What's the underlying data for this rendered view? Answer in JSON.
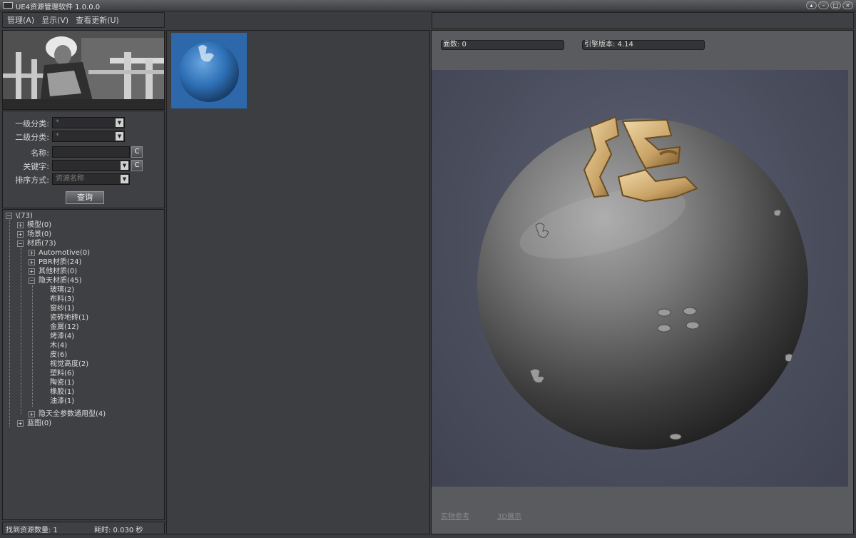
{
  "window": {
    "title": "UE4资源管理软件 1.0.0.0",
    "controls": [
      "restore",
      "minimize",
      "maximize",
      "close"
    ]
  },
  "menu": {
    "items": [
      "管理(A)",
      "显示(V)",
      "查看更新(U)"
    ]
  },
  "filters": {
    "category1_label": "一级分类:",
    "category1_value": "*",
    "category2_label": "二级分类:",
    "category2_value": "*",
    "name_label": "名称:",
    "name_value": "",
    "keyword_label": "关键字:",
    "keyword_value": "",
    "sort_label": "排序方式:",
    "sort_value": "资源名称",
    "clear_label": "C",
    "query_label": "查询"
  },
  "tree": {
    "root": "\\(73)",
    "nodes": {
      "models": "模型(0)",
      "scenes": "场景(0)",
      "materials": "材质(73)",
      "automotive": "Automotive(0)",
      "pbr": "PBR材质(24)",
      "other": "其他材质(0)",
      "yintian": "隐天材质(45)",
      "glass": "玻璃(2)",
      "fabric": "布料(3)",
      "curtain": "窗纱(1)",
      "tile": "瓷砖地砖(1)",
      "metal": "金属(12)",
      "paint_baked": "烤漆(4)",
      "wood": "木(4)",
      "leather": "皮(6)",
      "parallax": "视觉高度(2)",
      "plastic": "塑料(6)",
      "ceramic": "陶瓷(1)",
      "rubber": "橡胶(1)",
      "oil_paint": "油漆(1)",
      "yintian_params": "隐天全参数通用型(4)",
      "blueprint": "蓝图(0)"
    }
  },
  "status": {
    "found": "找到资源数量: 1",
    "elapsed": "耗时: 0.030 秒"
  },
  "info": {
    "faces": "面数: 0",
    "engine": "引擎版本: 4.14"
  },
  "links": {
    "instance": "实物参考",
    "view3d": "3D展示"
  },
  "colors": {
    "tile_bg": "#2c68aa",
    "panel_bg": "#3f4043",
    "viewport_bg": "#4a4d5c",
    "letter_gold": "#c8a265"
  }
}
